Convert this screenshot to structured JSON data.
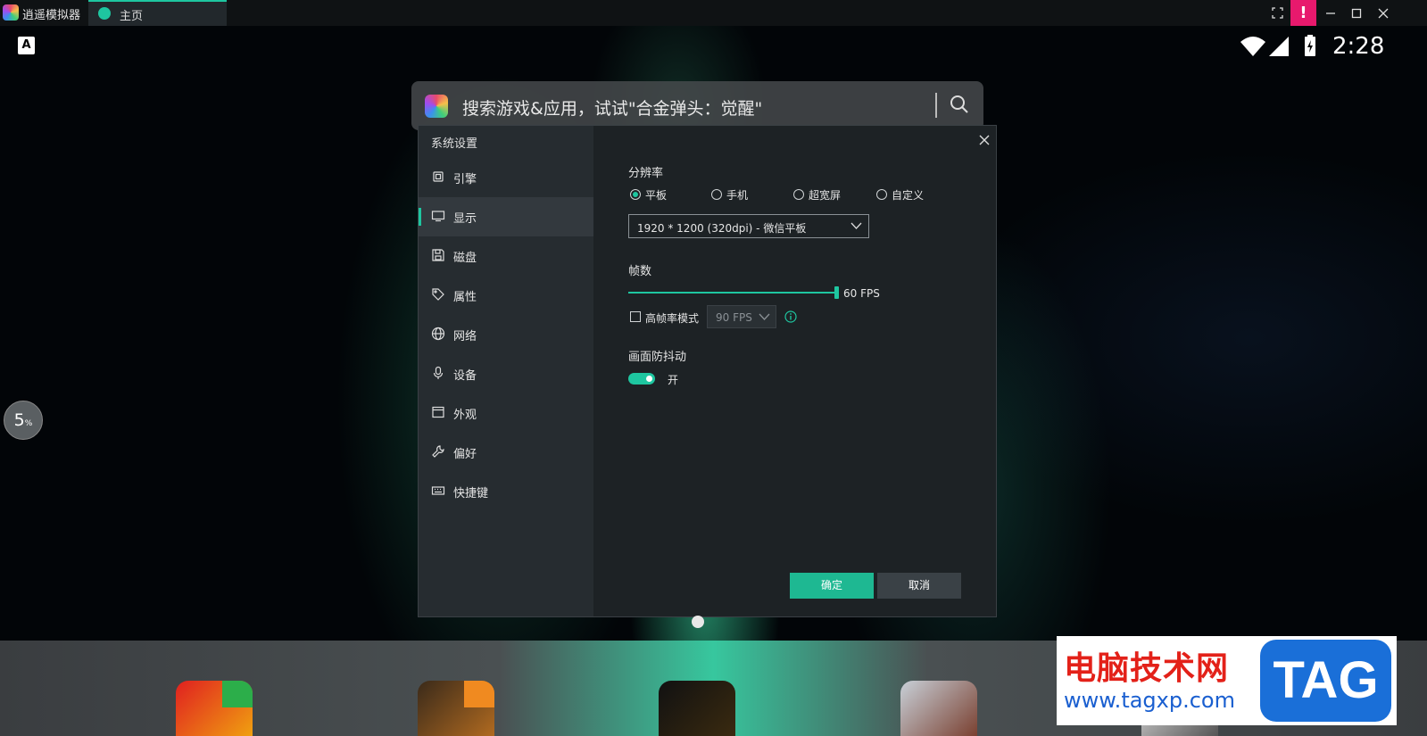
{
  "app": {
    "name": "逍遥模拟器",
    "tab": "主页"
  },
  "status": {
    "time": "2:28",
    "keyboard": "A"
  },
  "search": {
    "placeholder": "搜索游戏&应用，试试\"合金弹头：觉醒\""
  },
  "progress": {
    "value": "5",
    "unit": "%"
  },
  "dialog": {
    "title": "系统设置",
    "nav": [
      {
        "label": "引擎",
        "icon": "cpu-icon"
      },
      {
        "label": "显示",
        "icon": "monitor-icon",
        "active": true
      },
      {
        "label": "磁盘",
        "icon": "disk-icon"
      },
      {
        "label": "属性",
        "icon": "tag-icon"
      },
      {
        "label": "网络",
        "icon": "globe-icon"
      },
      {
        "label": "设备",
        "icon": "mic-icon"
      },
      {
        "label": "外观",
        "icon": "window-icon"
      },
      {
        "label": "偏好",
        "icon": "wrench-icon"
      },
      {
        "label": "快捷键",
        "icon": "keyboard-icon"
      }
    ],
    "resolution": {
      "label": "分辨率",
      "options": [
        "平板",
        "手机",
        "超宽屏",
        "自定义"
      ],
      "selected": "平板",
      "value": "1920 * 1200 (320dpi) - 微信平板"
    },
    "fps": {
      "label": "帧数",
      "value": "60 FPS",
      "slider_fraction": 1.0,
      "high_fps_label": "高帧率模式",
      "high_fps_checked": false,
      "high_fps_value": "90 FPS"
    },
    "anti_shake": {
      "label": "画面防抖动",
      "state": "开",
      "on": true
    },
    "ok": "确定",
    "cancel": "取消"
  },
  "watermark": {
    "title": "电脑技术网",
    "url": "www.tagxp.com",
    "logo": "TAG"
  },
  "colors": {
    "accent": "#1ec6a0",
    "alert": "#e8196d",
    "dialog_bg": "#1d2225",
    "sidebar_bg": "#262c30"
  }
}
